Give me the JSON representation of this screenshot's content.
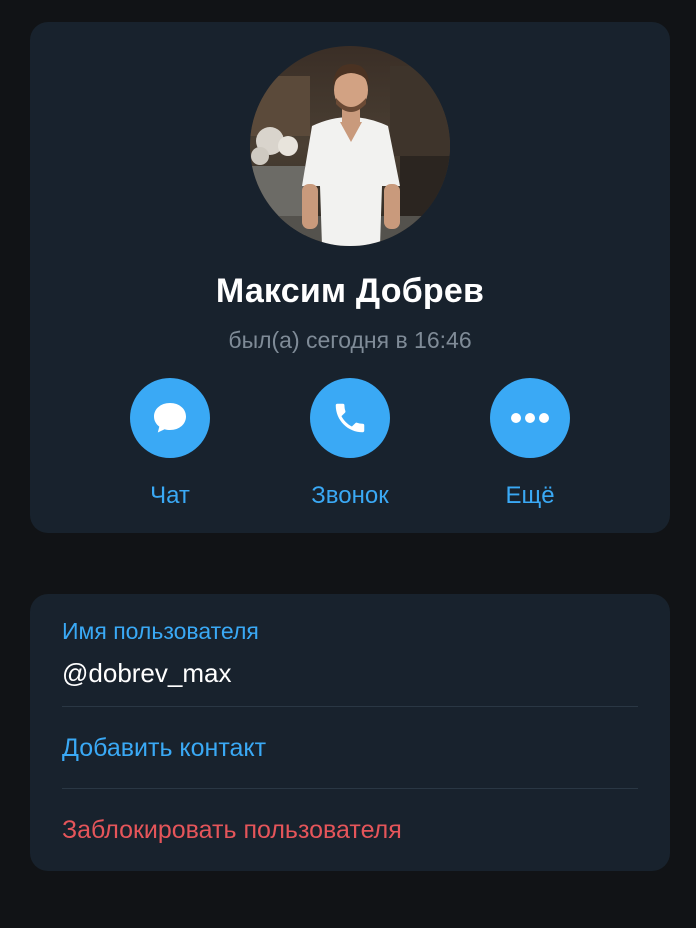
{
  "profile": {
    "name": "Максим Добрев",
    "status": "был(а) сегодня в 16:46",
    "avatar_icon": "user-photo"
  },
  "actions": [
    {
      "label": "Чат",
      "icon": "chat-bubble-icon"
    },
    {
      "label": "Звонок",
      "icon": "phone-icon"
    },
    {
      "label": "Ещё",
      "icon": "more-dots-icon"
    }
  ],
  "info": {
    "username_caption": "Имя пользователя",
    "username_value": "@dobrev_max",
    "add_contact_label": "Добавить контакт",
    "block_user_label": "Заблокировать пользователя"
  },
  "colors": {
    "background": "#111316",
    "card": "#18222d",
    "accent": "#3aa9f5",
    "danger": "#e5555a",
    "text_primary": "#ffffff",
    "text_secondary": "#7f8b97"
  }
}
